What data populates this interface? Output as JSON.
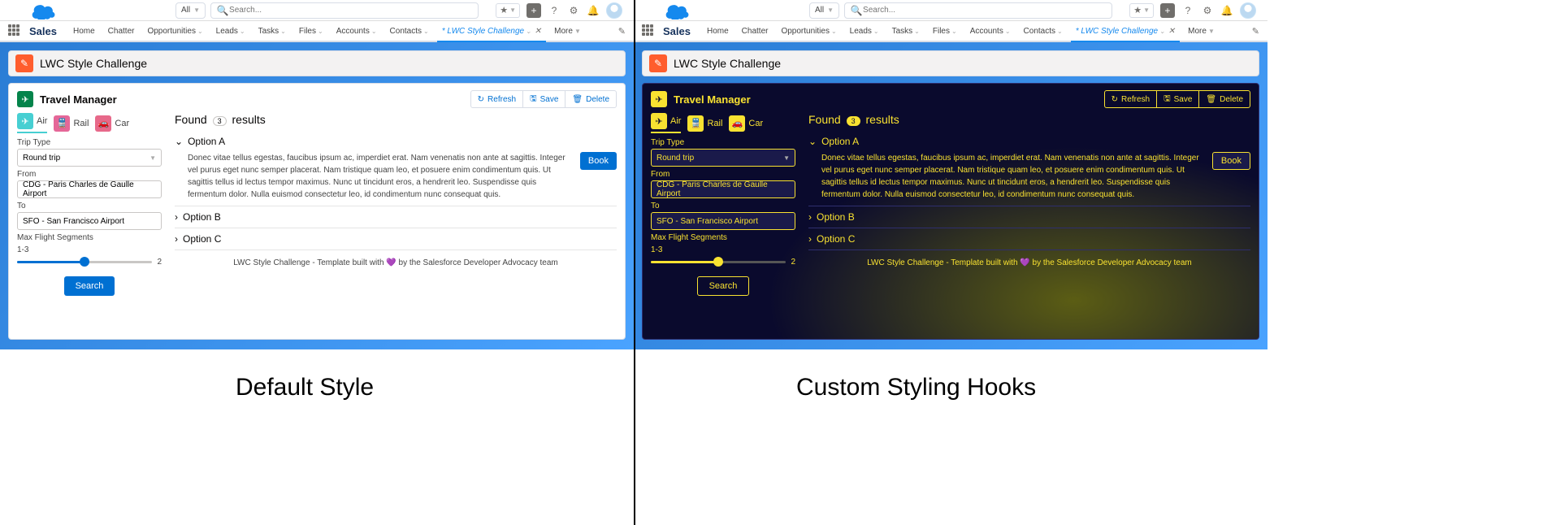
{
  "labels": {
    "left": "Default Style",
    "right": "Custom Styling Hooks"
  },
  "header": {
    "objectFilter": "All",
    "searchPlaceholder": "Search..."
  },
  "nav": {
    "appName": "Sales",
    "items": [
      "Home",
      "Chatter",
      "Opportunities",
      "Leads",
      "Tasks",
      "Files",
      "Accounts",
      "Contacts"
    ],
    "activeTab": "* LWC Style Challenge",
    "more": "More"
  },
  "page": {
    "title": "LWC Style Challenge"
  },
  "travel": {
    "title": "Travel Manager",
    "buttons": {
      "refresh": "Refresh",
      "save": "Save",
      "delete": "Delete"
    },
    "tabs": {
      "air": "Air",
      "rail": "Rail",
      "car": "Car"
    },
    "tripTypeLabel": "Trip Type",
    "tripTypeValue": "Round trip",
    "fromLabel": "From",
    "fromValue": "CDG - Paris Charles de Gaulle Airport",
    "toLabel": "To",
    "toValue": "SFO - San Francisco Airport",
    "segmentsLabel": "Max Flight Segments",
    "segmentsRange": "1-3",
    "segmentsMax": "2",
    "searchBtn": "Search"
  },
  "results": {
    "foundPrefix": "Found",
    "count": "3",
    "foundSuffix": "results",
    "optionA": "Option A",
    "optionB": "Option B",
    "optionC": "Option C",
    "lorem": "Donec vitae tellus egestas, faucibus ipsum ac, imperdiet erat. Nam venenatis non ante at sagittis. Integer vel purus eget nunc semper placerat. Nam tristique quam leo, et posuere enim condimentum quis. Ut sagittis tellus id lectus tempor maximus. Nunc ut tincidunt eros, a hendrerit leo. Suspendisse quis fermentum dolor. Nulla euismod consectetur leo, id condimentum nunc consequat quis.",
    "book": "Book"
  },
  "footer": {
    "text": "LWC Style Challenge - Template built with",
    "suffix": "by the Salesforce Developer Advocacy team"
  }
}
